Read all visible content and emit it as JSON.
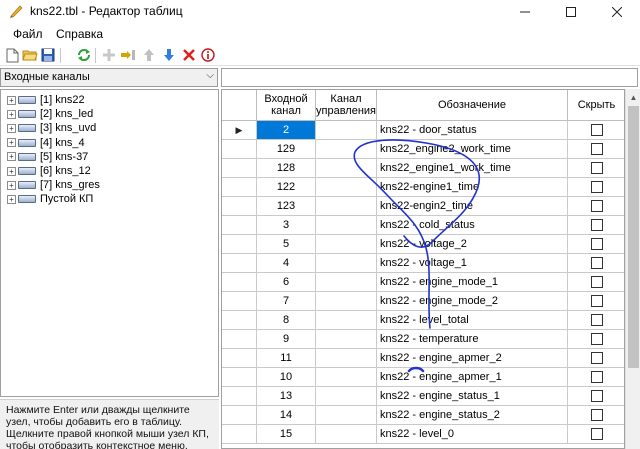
{
  "window": {
    "title": "kns22.tbl - Редактор таблиц"
  },
  "menu": [
    "Файл",
    "Справка"
  ],
  "toolbar": [
    "new-icon",
    "open-icon",
    "save-icon",
    "refresh-icon",
    "add-icon",
    "insert-icon",
    "move-up-icon",
    "move-down-icon",
    "delete-icon",
    "info-icon"
  ],
  "combo": {
    "value": "Входные каналы"
  },
  "filter": {
    "value": ""
  },
  "tree": [
    {
      "label": "[1] kns22"
    },
    {
      "label": "[2] kns_led"
    },
    {
      "label": "[3] kns_uvd"
    },
    {
      "label": "[4] kns_4"
    },
    {
      "label": "[5] kns-37"
    },
    {
      "label": "[6] kns_12"
    },
    {
      "label": "[7] kns_gres"
    },
    {
      "label": "Пустой КП"
    }
  ],
  "help_text": "Нажмите Enter или дважды щелкните узел, чтобы добавить его в таблицу. Щелкните правой кнопкой мыши узел КП, чтобы отобразить контекстное меню.",
  "grid": {
    "headers": {
      "input": "Входной канал",
      "control": "Канал управления",
      "name": "Обозначение",
      "hide": "Скрыть"
    },
    "rows": [
      {
        "input": "2",
        "control": "",
        "name": "kns22 - door_status",
        "hide": false,
        "selected": true
      },
      {
        "input": "129",
        "control": "",
        "name": "kns22_engine2_work_time",
        "hide": false
      },
      {
        "input": "128",
        "control": "",
        "name": "kns22_engine1_work_time",
        "hide": false
      },
      {
        "input": "122",
        "control": "",
        "name": "kns22-engine1_time",
        "hide": false
      },
      {
        "input": "123",
        "control": "",
        "name": "kns22-engin2_time",
        "hide": false
      },
      {
        "input": "3",
        "control": "",
        "name": "kns22 - cold_status",
        "hide": false
      },
      {
        "input": "5",
        "control": "",
        "name": "kns22 - voltage_2",
        "hide": false
      },
      {
        "input": "4",
        "control": "",
        "name": "kns22 - voltage_1",
        "hide": false
      },
      {
        "input": "6",
        "control": "",
        "name": "kns22 - engine_mode_1",
        "hide": false
      },
      {
        "input": "7",
        "control": "",
        "name": "kns22 - engine_mode_2",
        "hide": false
      },
      {
        "input": "8",
        "control": "",
        "name": "kns22 - level_total",
        "hide": false
      },
      {
        "input": "9",
        "control": "",
        "name": "kns22 - temperature",
        "hide": false
      },
      {
        "input": "11",
        "control": "",
        "name": "kns22 - engine_apmer_2",
        "hide": false
      },
      {
        "input": "10",
        "control": "",
        "name": "kns22 - engine_apmer_1",
        "hide": false
      },
      {
        "input": "13",
        "control": "",
        "name": "kns22 - engine_status_1",
        "hide": false
      },
      {
        "input": "14",
        "control": "",
        "name": "kns22 - engine_status_2",
        "hide": false
      },
      {
        "input": "15",
        "control": "",
        "name": "kns22 - level_0",
        "hide": false
      }
    ]
  },
  "colors": {
    "selection": "#0078d7",
    "annotation": "#2233cc"
  }
}
